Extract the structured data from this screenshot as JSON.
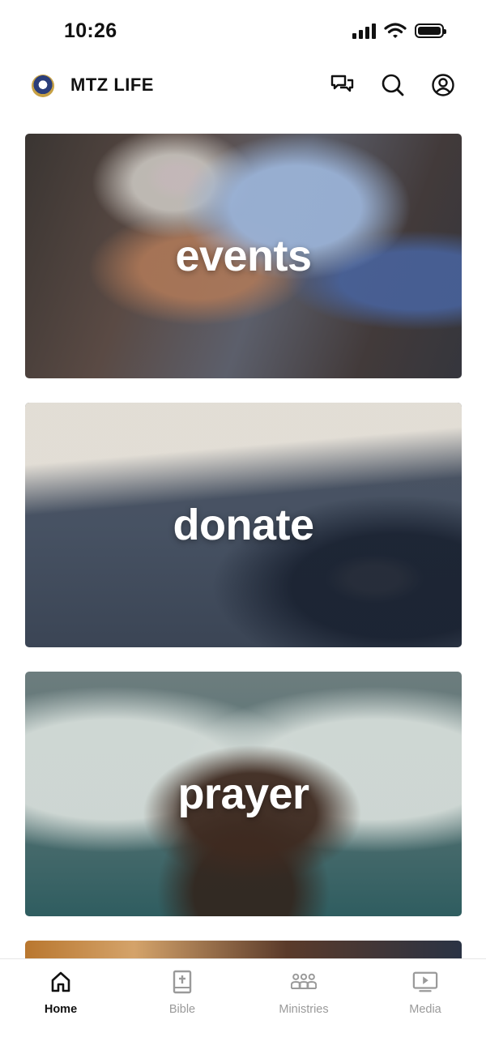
{
  "status_bar": {
    "time": "10:26"
  },
  "header": {
    "title": "MTZ LIFE"
  },
  "cards": [
    {
      "label": "events"
    },
    {
      "label": "donate"
    },
    {
      "label": "prayer"
    }
  ],
  "tabs": [
    {
      "label": "Home",
      "icon": "home-icon",
      "active": true
    },
    {
      "label": "Bible",
      "icon": "bible-icon",
      "active": false
    },
    {
      "label": "Ministries",
      "icon": "group-icon",
      "active": false
    },
    {
      "label": "Media",
      "icon": "media-icon",
      "active": false
    }
  ],
  "colors": {
    "active_tab": "#111111",
    "inactive_tab": "#9a9a9a"
  }
}
